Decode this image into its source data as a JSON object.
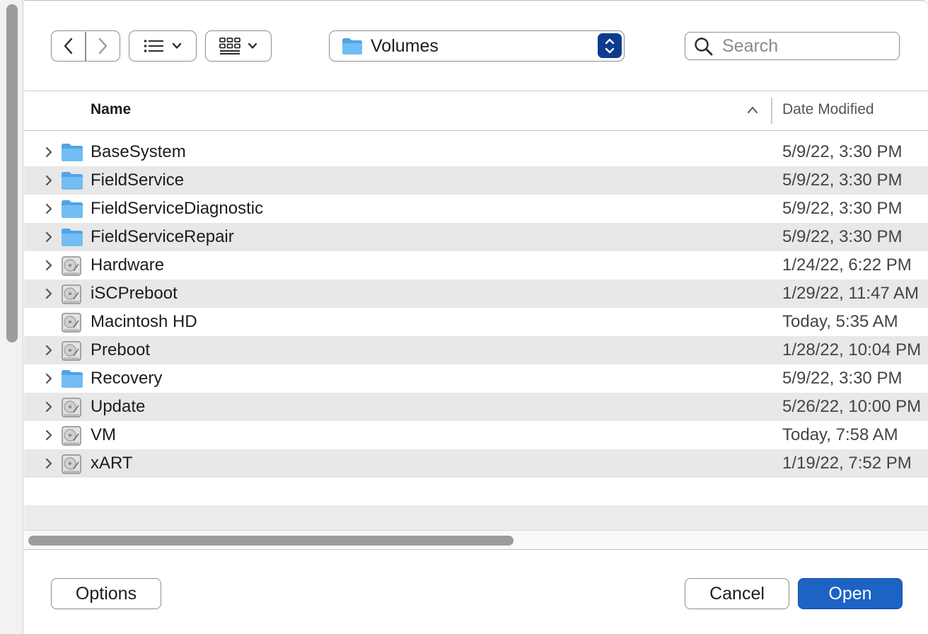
{
  "toolbar": {
    "back_icon": "chevron-left-icon",
    "forward_icon": "chevron-right-icon",
    "list_view_icon": "list-icon",
    "grid_view_icon": "grid-icon",
    "dropdown_icon": "chevron-down-icon",
    "location": "Volumes",
    "search_placeholder": "Search"
  },
  "list": {
    "columns": {
      "name": "Name",
      "date_modified": "Date Modified"
    },
    "sort_direction": "ascending",
    "items": [
      {
        "name": "BaseSystem",
        "kind": "folder",
        "expandable": true,
        "date": "5/9/22, 3:30 PM"
      },
      {
        "name": "FieldService",
        "kind": "folder",
        "expandable": true,
        "date": "5/9/22, 3:30 PM"
      },
      {
        "name": "FieldServiceDiagnostic",
        "kind": "folder",
        "expandable": true,
        "date": "5/9/22, 3:30 PM"
      },
      {
        "name": "FieldServiceRepair",
        "kind": "folder",
        "expandable": true,
        "date": "5/9/22, 3:30 PM"
      },
      {
        "name": "Hardware",
        "kind": "drive",
        "expandable": true,
        "date": "1/24/22, 6:22 PM"
      },
      {
        "name": "iSCPreboot",
        "kind": "drive",
        "expandable": true,
        "date": "1/29/22, 11:47 AM"
      },
      {
        "name": "Macintosh HD",
        "kind": "drive",
        "expandable": false,
        "date": "Today, 5:35 AM"
      },
      {
        "name": "Preboot",
        "kind": "drive",
        "expandable": true,
        "date": "1/28/22, 10:04 PM"
      },
      {
        "name": "Recovery",
        "kind": "folder",
        "expandable": true,
        "date": "5/9/22, 3:30 PM"
      },
      {
        "name": "Update",
        "kind": "drive",
        "expandable": true,
        "date": "5/26/22, 10:00 PM"
      },
      {
        "name": "VM",
        "kind": "drive",
        "expandable": true,
        "date": "Today, 7:58 AM"
      },
      {
        "name": "xART",
        "kind": "drive",
        "expandable": true,
        "date": "1/19/22, 7:52 PM"
      }
    ]
  },
  "buttons": {
    "options": "Options",
    "cancel": "Cancel",
    "open": "Open"
  },
  "colors": {
    "accent": "#1d63c4",
    "folder": "#62b5f0",
    "path_stepper": "#0d3c8f",
    "row_alt": "#e8e8e8"
  }
}
